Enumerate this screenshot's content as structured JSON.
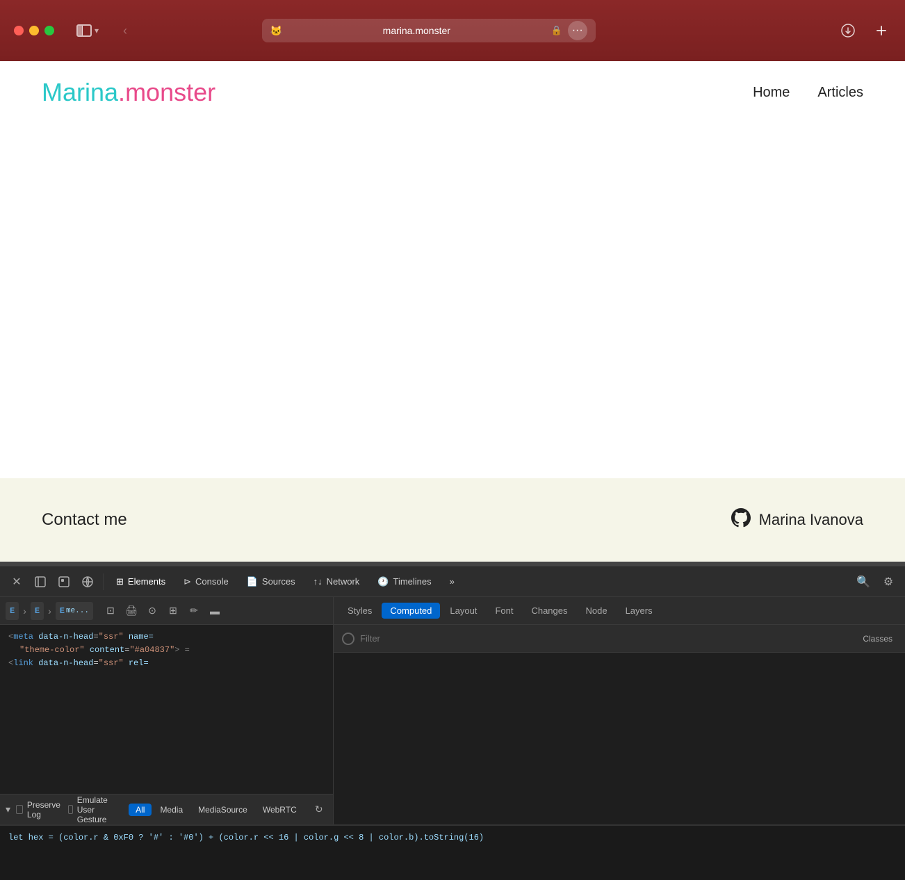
{
  "browser": {
    "url": "marina.monster",
    "favicon": "🐱",
    "title": "marina.monster"
  },
  "webpage": {
    "logo": {
      "marina": "Marina",
      "dot": ".",
      "monster": "monster"
    },
    "nav": {
      "home": "Home",
      "articles": "Articles"
    },
    "footer": {
      "contact": "Contact me",
      "author": "Marina Ivanova"
    }
  },
  "devtools": {
    "toolbar": {
      "close_label": "×",
      "tabs": [
        {
          "id": "elements",
          "label": "Elements",
          "icon": "⊞",
          "active": true
        },
        {
          "id": "console",
          "label": "Console",
          "icon": "⊳",
          "active": false
        },
        {
          "id": "sources",
          "label": "Sources",
          "icon": "📄",
          "active": false
        },
        {
          "id": "network",
          "label": "Network",
          "icon": "↑↓",
          "active": false
        },
        {
          "id": "timelines",
          "label": "Timelines",
          "icon": "🕐",
          "active": false
        }
      ],
      "more_tabs": "»"
    },
    "breadcrumb": {
      "items": [
        {
          "label": "E",
          "text": ""
        },
        {
          "label": "E",
          "text": ""
        },
        {
          "label": "E",
          "text": "me..."
        }
      ]
    },
    "dom": {
      "line1_tag_open": "<meta ",
      "line1_attr1_name": "data-n-head",
      "line1_attr1_value": "\"ssr\"",
      "line1_attr2_name": "name=",
      "line1_attr2_value": "\"theme-color\"",
      "line1_attr3_name": "content",
      "line1_attr3_value": "\"#a04837\"",
      "line1_tag_close": "> =",
      "line2_tag": "<link ",
      "line2_attr1_name": "data-n-head",
      "line2_attr1_value": "\"ssr\"",
      "line2_attr2_name": "rel="
    },
    "styles_tabs": [
      "Styles",
      "Computed",
      "Layout",
      "Font",
      "Changes",
      "Node",
      "Layers"
    ],
    "active_style_tab": "Computed",
    "filter_placeholder": "Filter",
    "filter_classes": "Classes",
    "bottom": {
      "preserve_log": "Preserve Log",
      "emulate_gesture": "Emulate User Gesture",
      "filter_tabs": [
        "All",
        "Media",
        "MediaSource",
        "WebRTC"
      ]
    },
    "console_text": "let hex = (color.r & 0xF0 ? '#' : '#0') + (color.r << 16 | color.g << 8 | color.b).toString(16)"
  }
}
